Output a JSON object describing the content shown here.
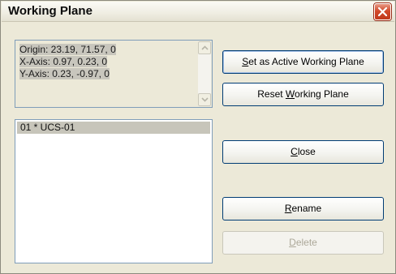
{
  "window": {
    "title": "Working Plane"
  },
  "info": {
    "lines": [
      "Origin: 23.19, 71.57, 0",
      "X-Axis: 0.97, 0.23, 0",
      "Y-Axis: 0.23, -0.97, 0"
    ]
  },
  "list": {
    "items": [
      {
        "label": "01 *  UCS-01",
        "selected": true
      }
    ]
  },
  "buttons": {
    "set_active": {
      "pre": "",
      "mnemonic": "S",
      "post": "et as Active Working Plane"
    },
    "reset": {
      "pre": "Reset ",
      "mnemonic": "W",
      "post": "orking Plane"
    },
    "close": {
      "pre": "",
      "mnemonic": "C",
      "post": "lose"
    },
    "rename": {
      "pre": "",
      "mnemonic": "R",
      "post": "ename"
    },
    "delete": {
      "pre": "",
      "mnemonic": "D",
      "post": "elete",
      "disabled": true
    }
  },
  "icons": {
    "close": "close-x-icon",
    "scroll_up": "chevron-up-icon",
    "scroll_down": "chevron-down-icon"
  },
  "colors": {
    "dialog_bg": "#ece9d8",
    "close_button": "#d2492a",
    "button_border": "#003c74",
    "selection": "#c7c5ba",
    "field_border": "#7f9db9"
  }
}
